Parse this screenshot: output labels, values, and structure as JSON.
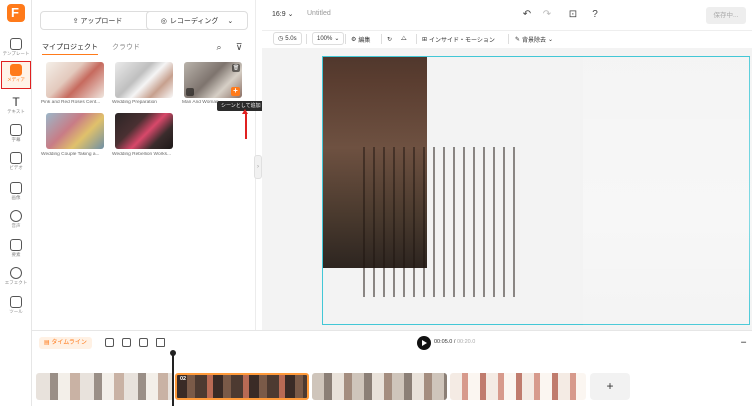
{
  "rail": {
    "items": [
      {
        "label": "テンプレート",
        "icon": "template-icon"
      },
      {
        "label": "メディア",
        "icon": "media-icon"
      },
      {
        "label": "テキスト",
        "icon": "text-icon"
      },
      {
        "label": "字幕",
        "icon": "subtitle-icon"
      },
      {
        "label": "ビデオ",
        "icon": "video-icon"
      },
      {
        "label": "画像",
        "icon": "image-icon"
      },
      {
        "label": "音声",
        "icon": "audio-icon"
      },
      {
        "label": "要素",
        "icon": "elements-icon"
      },
      {
        "label": "エフェクト",
        "icon": "effects-icon"
      },
      {
        "label": "ツール",
        "icon": "tools-icon"
      }
    ]
  },
  "panel": {
    "upload_label": "アップロード",
    "record_label": "レコーディング",
    "tabs": [
      "マイプロジェクト",
      "クラウド"
    ],
    "media": [
      {
        "caption": "Pink and Red Roses Cent..."
      },
      {
        "caption": "Wedding Preparation"
      },
      {
        "caption": "Man And Woman..."
      },
      {
        "caption": "Wedding Couple Taking a..."
      },
      {
        "caption": "Wedding Rebellion Works..."
      }
    ],
    "tooltip": "シーンとして追加"
  },
  "topbar": {
    "ratio": "16:9",
    "title": "Untitled",
    "export_label": "保存中..."
  },
  "edit_toolbar": {
    "duration": "5.0s",
    "zoom": "100%",
    "edit_label": "編集",
    "transition_label": "インサイド・モーション",
    "bg_label": "背景除去"
  },
  "timeline": {
    "label": "タイムライン",
    "current": "00:05.0",
    "total": "00:20.0",
    "selected_clip_number": "02",
    "add_label": "+"
  },
  "colors": {
    "accent": "#ff7a1a",
    "selection": "#42c7d6",
    "annotation": "#e02020"
  }
}
